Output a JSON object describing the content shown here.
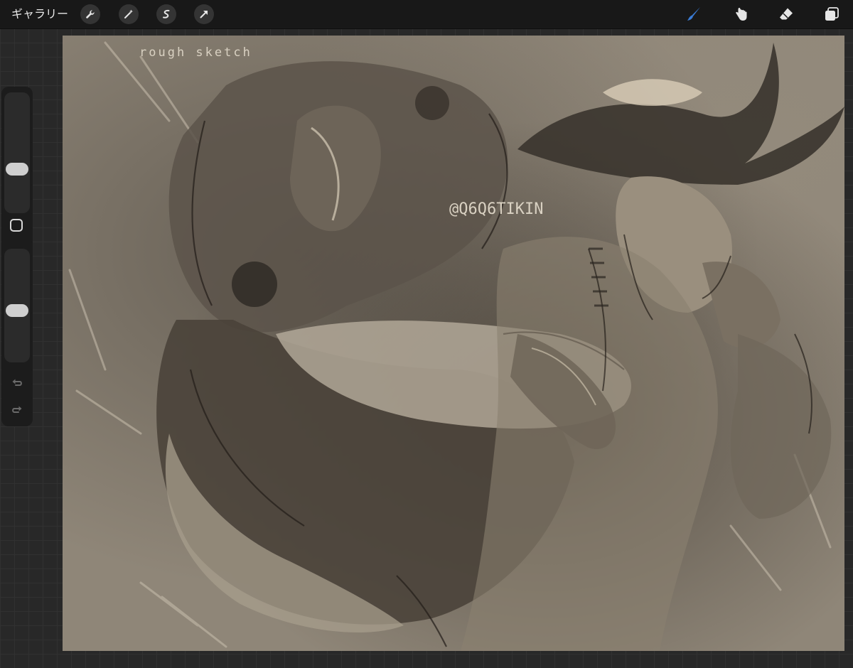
{
  "toolbar": {
    "gallery_label": "ギャラリー",
    "left_tools": [
      "wrench-icon",
      "magic-wand-icon",
      "selection-icon",
      "transform-arrow-icon"
    ],
    "right_tools": [
      "brush-icon",
      "smudge-icon",
      "eraser-icon",
      "layers-icon"
    ],
    "active_tool_color": "#3a7bd5"
  },
  "sidebar": {
    "brush_size_level": 0.35,
    "opacity_level": 0.45,
    "undo_icon": "undo-icon",
    "redo_icon": "redo-icon"
  },
  "canvas": {
    "text_rough_sketch": "rough sketch",
    "text_watermark": "@Q6Q6TIKIN",
    "colors": {
      "paper": "#8f8678",
      "ink": "#2a2520",
      "highlight": "#e8dcc6"
    }
  }
}
